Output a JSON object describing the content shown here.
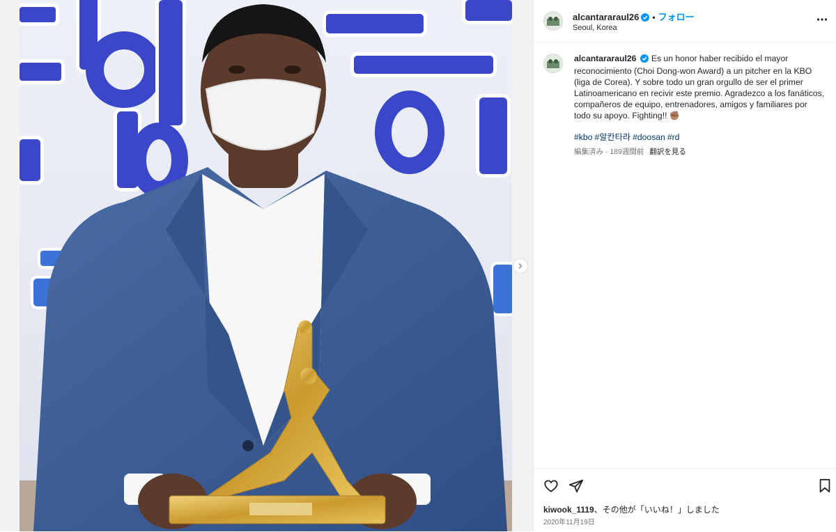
{
  "post": {
    "username": "alcantararaul26",
    "follow_label": "フォロー",
    "separator": "•",
    "location": "Seoul, Korea"
  },
  "caption": {
    "username": "alcantararaul26",
    "text": "Es un honor haber recibido el mayor reconocimiento (Choi Dong-won Award) a un pitcher en la KBO (liga de Corea). Y sobre todo un gran orgullo de ser el primer Latinoamericano en recivir este premio. Agradezco a los fanáticos, compañeros de equipo, entrenadores, amigos y familiares por todo su apoyo. Fighting!! ",
    "emoji": "✊🏽",
    "hashtags": [
      "#kbo",
      "#알칸타라",
      "#doosan",
      "#rd"
    ],
    "edited": "編集済み",
    "age": "189週間前",
    "translate": "翻訳を見る"
  },
  "footer": {
    "liker": "kiwook_1119",
    "likes_suffix": "、その他が「いいね！」しました",
    "date": "2020年11月19日"
  },
  "icons": {
    "like": "heart-icon",
    "share": "paper-plane-icon",
    "save": "bookmark-icon",
    "more": "more-horizontal-icon",
    "next": "chevron-right-icon",
    "verified": "verified-badge-icon"
  },
  "colors": {
    "accent": "#0095f6",
    "hashtag": "#00376b",
    "muted": "#737373",
    "suit": "#3b5c93",
    "trophy": "#d4ae4a",
    "backdrop_text": "#3a47c9"
  }
}
